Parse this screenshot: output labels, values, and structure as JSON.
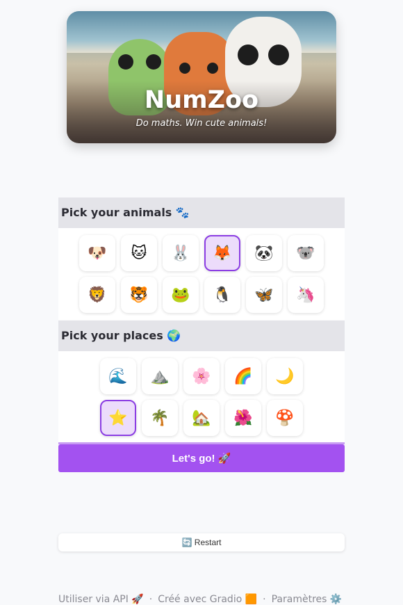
{
  "banner": {
    "title": "NumZoo",
    "subtitle": "Do maths. Win cute animals!"
  },
  "animals": {
    "heading": "Pick your animals 🐾",
    "items": [
      "🐶",
      "🐱",
      "🐰",
      "🦊",
      "🐼",
      "🐨",
      "🦁",
      "🐯",
      "🐸",
      "🐧",
      "🦋",
      "🦄"
    ],
    "selected": "🦊"
  },
  "places": {
    "heading": "Pick your places 🌍",
    "items": [
      "🌊",
      "⛰️",
      "🌸",
      "🌈",
      "🌙",
      "⭐",
      "🌴",
      "🏡",
      "🌺",
      "🍄"
    ],
    "selected": "⭐"
  },
  "go_button": "Let's go! 🚀",
  "restart_button": "🔄 Restart",
  "footer": {
    "api": "Utiliser via API 🚀",
    "built": "Créé avec Gradio 🟧",
    "settings": "Paramètres ⚙️",
    "separator": "·"
  },
  "colors": {
    "accent": "#a352f0",
    "selected_border": "#8b3de3",
    "selected_bg": "#ecdcfb",
    "section_bg": "#e4e4e9"
  }
}
